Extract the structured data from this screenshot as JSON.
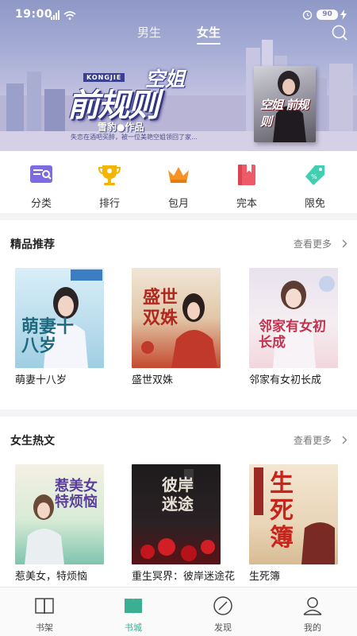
{
  "status": {
    "time": "19:00",
    "battery": "90"
  },
  "top_tabs": [
    {
      "label": "男生"
    },
    {
      "label": "女生"
    }
  ],
  "banner": {
    "title_small": "空姐",
    "title_en": "KONGJIE",
    "title_main": "前规则",
    "author_line": "雪豹●作品",
    "description": "失恋在酒吧买醉，被一位美艳空姐领回了家…",
    "cover_title": "空姐 前规则"
  },
  "categories": [
    {
      "label": "分类",
      "icon": "category-icon",
      "color": "#7d6ce0"
    },
    {
      "label": "排行",
      "icon": "trophy-icon",
      "color": "#f4b400"
    },
    {
      "label": "包月",
      "icon": "crown-icon",
      "color": "#f59223"
    },
    {
      "label": "完本",
      "icon": "book-icon",
      "color": "#ef5a67"
    },
    {
      "label": "限免",
      "icon": "tag-icon",
      "color": "#3fd0b2"
    }
  ],
  "sections": [
    {
      "title": "精品推荐",
      "more": "查看更多",
      "books": [
        {
          "name": "萌妻十八岁",
          "cover_text": "萌妻十八岁"
        },
        {
          "name": "盛世双姝",
          "cover_text": "盛世双姝"
        },
        {
          "name": "邻家有女初长成",
          "cover_text": "邻家有女初长成"
        }
      ]
    },
    {
      "title": "女生热文",
      "more": "查看更多",
      "books": [
        {
          "name": "惹美女，特烦恼",
          "cover_text": "惹美女特烦恼"
        },
        {
          "name": "重生冥界：彼岸迷途花",
          "cover_text": "彼岸迷途"
        },
        {
          "name": "生死簿",
          "cover_text": "生死簿"
        }
      ]
    }
  ],
  "bottom_nav": [
    {
      "label": "书架",
      "icon": "bookshelf-icon"
    },
    {
      "label": "书城",
      "icon": "bookstore-icon",
      "active": true
    },
    {
      "label": "发现",
      "icon": "compass-icon"
    },
    {
      "label": "我的",
      "icon": "profile-icon"
    }
  ],
  "colors": {
    "accent": "#3aaf92",
    "banner_bg": "#a7aed6"
  }
}
